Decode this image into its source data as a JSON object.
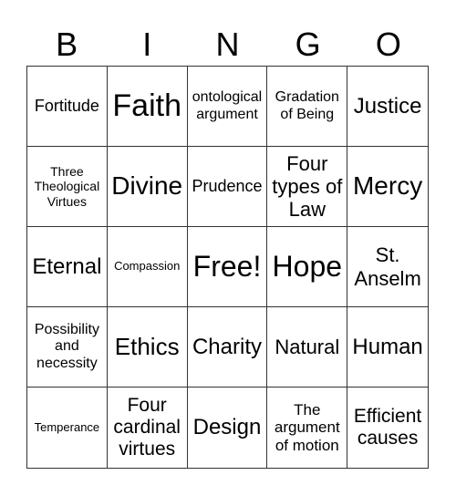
{
  "header": [
    "B",
    "I",
    "N",
    "G",
    "O"
  ],
  "cells": [
    "Fortitude",
    "Faith",
    "ontological argument",
    "Gradation of Being",
    "Justice",
    "Three Theological Virtues",
    "Divine",
    "Prudence",
    "Four types of Law",
    "Mercy",
    "Eternal",
    "Compassion",
    "Free!",
    "Hope",
    "St. Anselm",
    "Possibility and necessity",
    "Ethics",
    "Charity",
    "Natural",
    "Human",
    "Temperance",
    "Four cardinal virtues",
    "Design",
    "The argument of motion",
    "Efficient causes"
  ]
}
